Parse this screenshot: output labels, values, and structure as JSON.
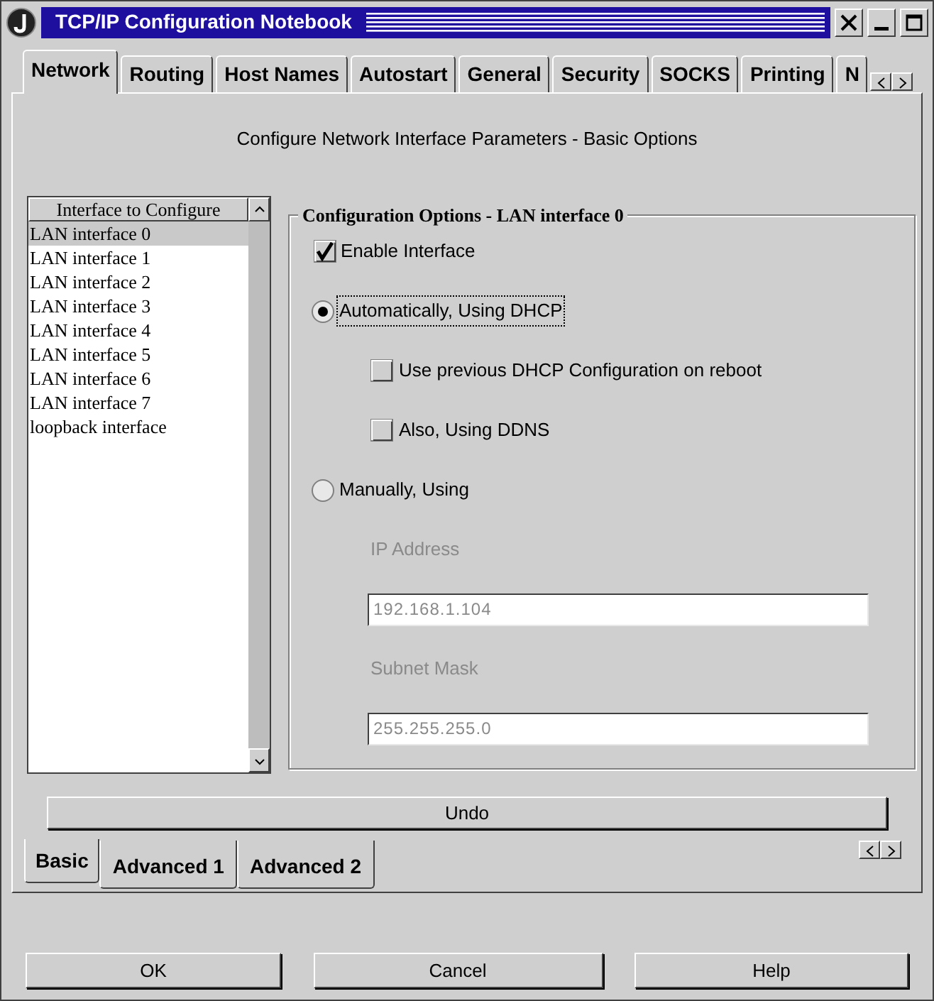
{
  "window": {
    "title": "TCP/IP Configuration Notebook"
  },
  "tabs": [
    {
      "label": "Network",
      "selected": true
    },
    {
      "label": "Routing",
      "selected": false
    },
    {
      "label": "Host Names",
      "selected": false
    },
    {
      "label": "Autostart",
      "selected": false
    },
    {
      "label": "General",
      "selected": false
    },
    {
      "label": "Security",
      "selected": false
    },
    {
      "label": "SOCKS",
      "selected": false
    },
    {
      "label": "Printing",
      "selected": false
    },
    {
      "label": "N",
      "selected": false
    }
  ],
  "heading": "Configure Network Interface Parameters - Basic Options",
  "interface_list": {
    "header": "Interface to Configure",
    "items": [
      {
        "label": "LAN interface 0",
        "selected": true
      },
      {
        "label": "LAN interface 1",
        "selected": false
      },
      {
        "label": "LAN interface 2",
        "selected": false
      },
      {
        "label": "LAN interface 3",
        "selected": false
      },
      {
        "label": "LAN interface 4",
        "selected": false
      },
      {
        "label": "LAN interface 5",
        "selected": false
      },
      {
        "label": "LAN interface 6",
        "selected": false
      },
      {
        "label": "LAN interface 7",
        "selected": false
      },
      {
        "label": "loopback interface",
        "selected": false
      }
    ]
  },
  "config": {
    "title": "Configuration Options - LAN interface 0",
    "enable": {
      "label": "Enable Interface",
      "checked": true
    },
    "modes": [
      {
        "label": "Automatically, Using DHCP",
        "selected": true,
        "focused": true,
        "children": [
          {
            "kind": "checkbox",
            "label": "Use previous DHCP Configuration on reboot",
            "checked": false
          },
          {
            "kind": "checkbox",
            "label": "Also, Using DDNS",
            "checked": false
          }
        ]
      },
      {
        "label": "Manually, Using",
        "selected": false,
        "focused": false,
        "children": [
          {
            "kind": "field",
            "label": "IP Address",
            "value": "192.168.1.104",
            "disabled": true
          },
          {
            "kind": "field",
            "label": "Subnet Mask",
            "value": "255.255.255.0",
            "disabled": true
          }
        ]
      }
    ]
  },
  "undo_button": "Undo",
  "sub_tabs": [
    {
      "label": "Basic",
      "selected": true
    },
    {
      "label": "Advanced 1",
      "selected": false
    },
    {
      "label": "Advanced 2",
      "selected": false
    }
  ],
  "buttons": [
    "OK",
    "Cancel",
    "Help"
  ]
}
